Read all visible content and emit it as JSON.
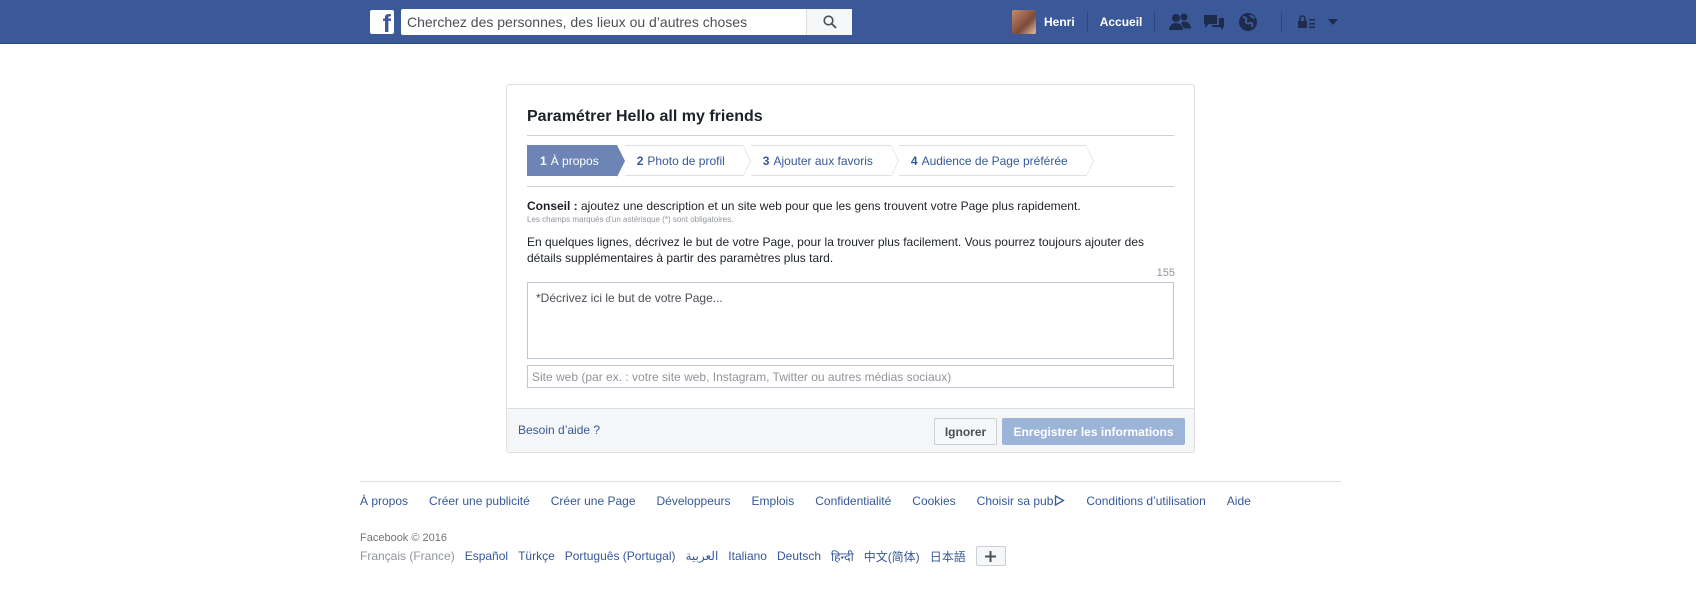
{
  "topbar": {
    "logo_letter": "f",
    "search_placeholder": "Cherchez des personnes, des lieux ou d’autres choses",
    "user_name": "Henri",
    "home_label": "Accueil",
    "icons": [
      "friend-requests-icon",
      "messages-icon",
      "notifications-globe-icon",
      "privacy-lock-icon",
      "account-menu-chevron-icon"
    ],
    "brand_color": "#3b5998"
  },
  "setup": {
    "title": "Paramétrer Hello all my friends",
    "steps": [
      {
        "num": "1",
        "label": "À propos",
        "active": true
      },
      {
        "num": "2",
        "label": "Photo de profil",
        "active": false
      },
      {
        "num": "3",
        "label": "Ajouter aux favoris",
        "active": false
      },
      {
        "num": "4",
        "label": "Audience de Page préférée",
        "active": false
      }
    ],
    "tip_label": "Conseil :",
    "tip_text": " ajoutez une description et un site web pour que les gens trouvent votre Page plus rapidement.",
    "required_note": "Les champs marqués d’un astérisque (*) sont obligatoires.",
    "description": "En quelques lignes, décrivez le but de votre Page, pour la trouver plus facilement. Vous pourrez toujours ajouter des détails supplémentaires à partir des paramètres plus tard.",
    "char_counter": "155",
    "textarea_placeholder": "*Décrivez ici le but de votre Page...",
    "website_placeholder": "Site web (par ex. : votre site web, Instagram, Twitter ou autres médias sociaux)",
    "help_link": "Besoin d’aide ?",
    "ignore_button": "Ignorer",
    "save_button": "Enregistrer les informations"
  },
  "footer": {
    "links": [
      "À propos",
      "Créer une publicité",
      "Créer une Page",
      "Développeurs",
      "Emplois",
      "Confidentialité",
      "Cookies",
      "Choisir sa pub",
      "Conditions d’utilisation",
      "Aide"
    ],
    "copyright": "Facebook © 2016",
    "current_language": "Français (France)",
    "languages": [
      "Español",
      "Türkçe",
      "Português (Portugal)",
      "العربية",
      "Italiano",
      "Deutsch",
      "हिन्दी",
      "中文(简体)",
      "日本語"
    ],
    "more_languages": "+"
  }
}
